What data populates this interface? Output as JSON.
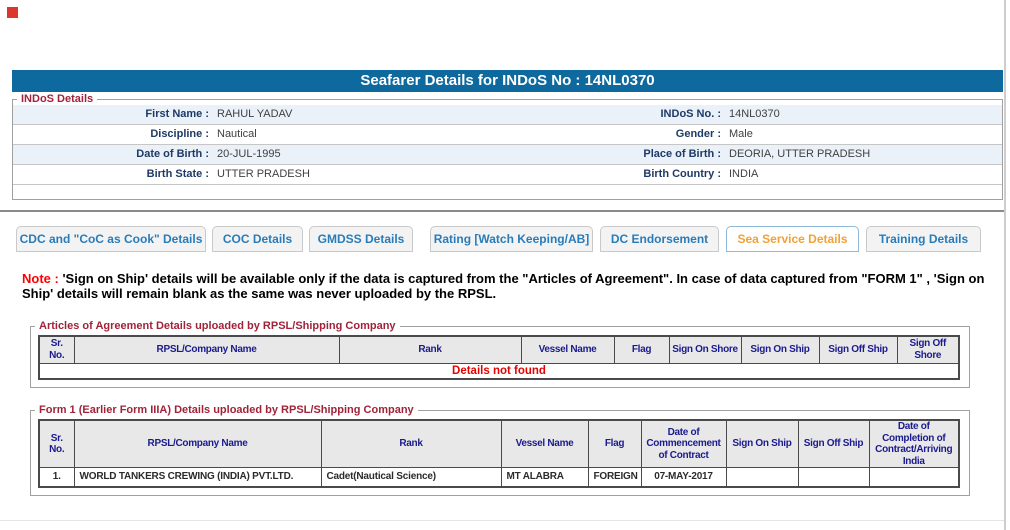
{
  "page": {
    "title": "Seafarer Details for INDoS No : 14NL0370"
  },
  "indos_details": {
    "legend": "INDoS Details",
    "rows": [
      {
        "l_label": "First Name :",
        "l_value": "RAHUL YADAV",
        "r_label": "INDoS No. :",
        "r_value": "14NL0370"
      },
      {
        "l_label": "Discipline :",
        "l_value": "Nautical",
        "r_label": "Gender :",
        "r_value": "Male"
      },
      {
        "l_label": "Date of Birth :",
        "l_value": "20-JUL-1995",
        "r_label": "Place of Birth :",
        "r_value": "DEORIA, UTTER PRADESH"
      },
      {
        "l_label": "Birth State :",
        "l_value": "UTTER PRADESH",
        "r_label": "Birth Country :",
        "r_value": "INDIA"
      }
    ]
  },
  "tabs": [
    {
      "label": "CDC and \"CoC as Cook\" Details",
      "active": false
    },
    {
      "label": "COC Details",
      "active": false
    },
    {
      "label": "GMDSS Details",
      "active": false
    },
    {
      "label": "Rating [Watch Keeping/AB]",
      "active": false
    },
    {
      "label": "DC Endorsement",
      "active": false
    },
    {
      "label": "Sea Service Details",
      "active": true
    },
    {
      "label": "Training Details",
      "active": false
    }
  ],
  "note": {
    "prefix": "Note :",
    "text": " 'Sign on Ship' details will be available only if the data is captured from the \"Articles of Agreement\". In case of data captured from \"FORM 1\" , 'Sign on Ship' details will remain blank as the same was never uploaded by the RPSL."
  },
  "articles_section": {
    "legend": "Articles of Agreement Details uploaded by RPSL/Shipping Company",
    "headers": [
      "Sr. No.",
      "RPSL/Company Name",
      "Rank",
      "Vessel Name",
      "Flag",
      "Sign On Shore",
      "Sign On Ship",
      "Sign Off Ship",
      "Sign Off Shore"
    ],
    "empty_text": "Details not found"
  },
  "form1_section": {
    "legend": "Form 1 (Earlier Form IIIA) Details uploaded by RPSL/Shipping Company",
    "headers": [
      "Sr. No.",
      "RPSL/Company Name",
      "Rank",
      "Vessel Name",
      "Flag",
      "Date of Commencement of Contract",
      "Sign On Ship",
      "Sign Off Ship",
      "Date of Completion of Contract/Arriving India"
    ],
    "rows": [
      [
        "1.",
        "WORLD TANKERS CREWING (INDIA) PVT.LTD.",
        "Cadet(Nautical Science)",
        "MT ALABRA",
        "FOREIGN",
        "07-MAY-2017",
        "",
        "",
        ""
      ]
    ]
  },
  "colors": {
    "title_bar_bg": "#0E699E",
    "legend_maroon": "#A12339",
    "tab_blue": "#2A7CB9",
    "tab_active_orange": "#F0A236",
    "note_red": "#FF0000",
    "table_header_navy": "#1B1B8F",
    "empty_state_red": "#E60000",
    "row_alt_blue": "#EAF1F9"
  }
}
